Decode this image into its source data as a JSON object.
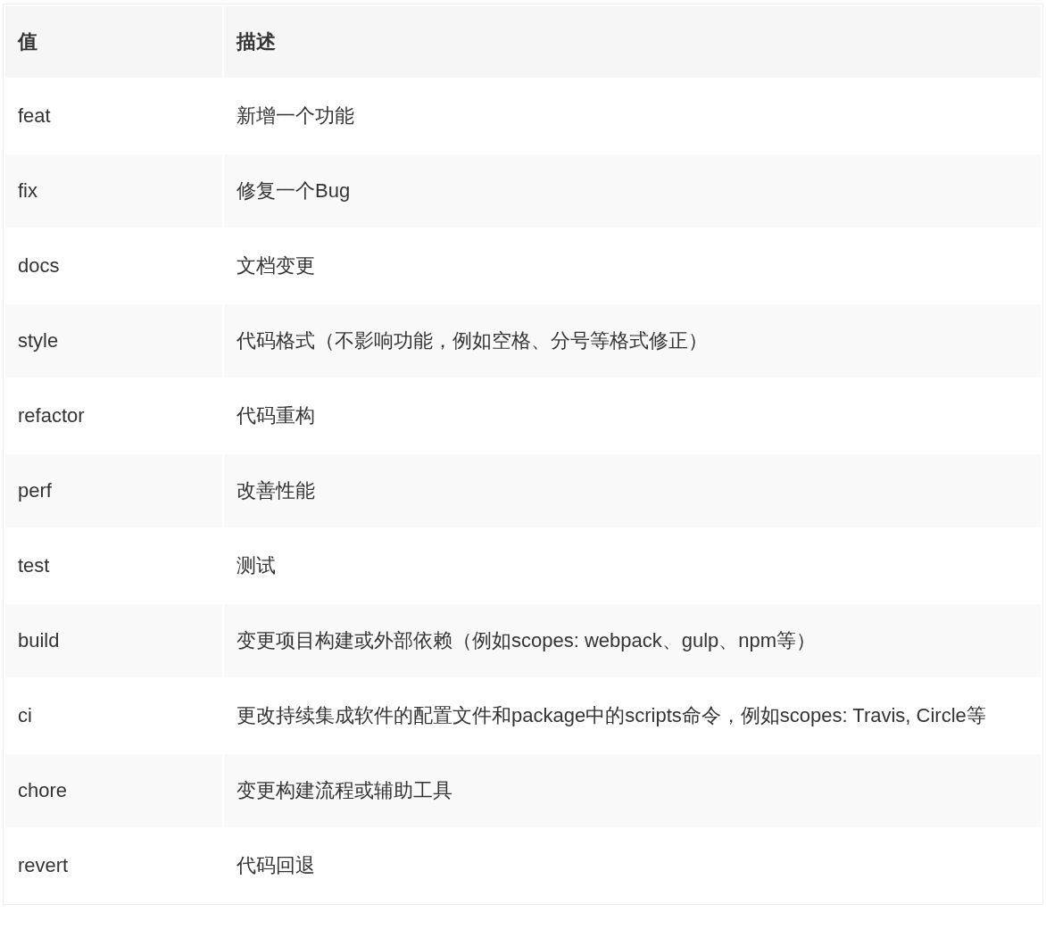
{
  "table": {
    "columns": [
      "值",
      "描述"
    ],
    "rows": [
      {
        "value": "feat",
        "description": "新增一个功能"
      },
      {
        "value": "fix",
        "description": "修复一个Bug"
      },
      {
        "value": "docs",
        "description": "文档变更"
      },
      {
        "value": "style",
        "description": "代码格式（不影响功能，例如空格、分号等格式修正）"
      },
      {
        "value": "refactor",
        "description": "代码重构"
      },
      {
        "value": "perf",
        "description": "改善性能"
      },
      {
        "value": "test",
        "description": "测试"
      },
      {
        "value": "build",
        "description": "变更项目构建或外部依赖（例如scopes: webpack、gulp、npm等）"
      },
      {
        "value": "ci",
        "description": "更改持续集成软件的配置文件和package中的scripts命令，例如scopes: Travis, Circle等"
      },
      {
        "value": "chore",
        "description": "变更构建流程或辅助工具"
      },
      {
        "value": "revert",
        "description": "代码回退"
      }
    ]
  }
}
